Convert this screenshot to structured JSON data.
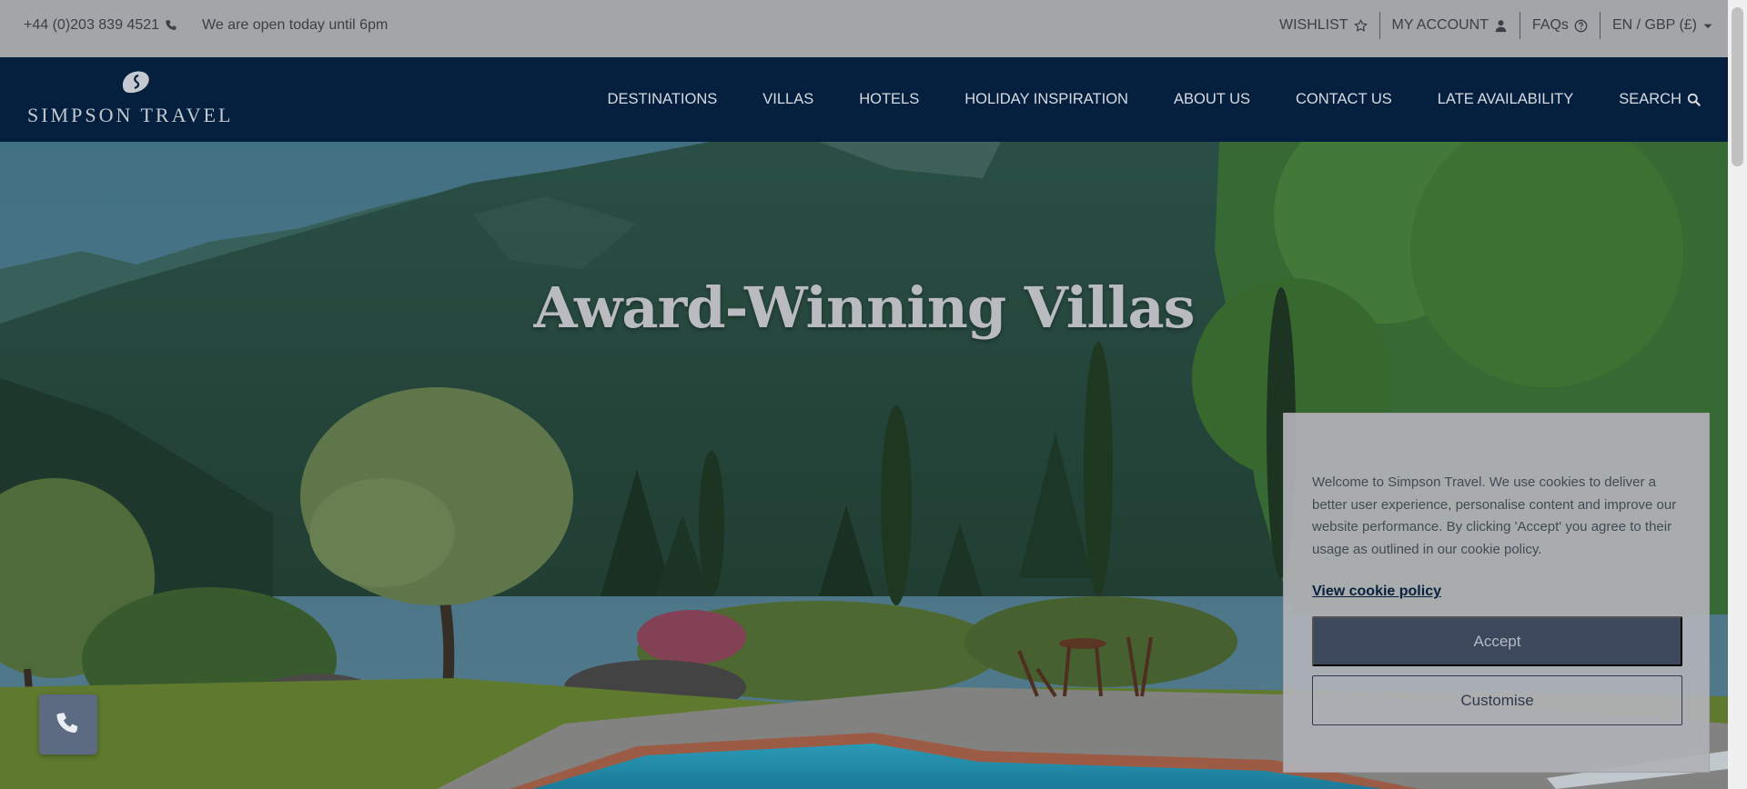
{
  "topbar": {
    "phone": "+44 (0)203 839 4521",
    "hours": "We are open today until 6pm",
    "wishlist": "WISHLIST",
    "account": "MY ACCOUNT",
    "faqs": "FAQs",
    "locale": "EN / GBP (£)"
  },
  "nav": {
    "logo_text": "SIMPSON TRAVEL",
    "items": [
      {
        "label": "DESTINATIONS"
      },
      {
        "label": "VILLAS"
      },
      {
        "label": "HOTELS"
      },
      {
        "label": "HOLIDAY INSPIRATION"
      },
      {
        "label": "ABOUT US"
      },
      {
        "label": "CONTACT US"
      },
      {
        "label": "LATE AVAILABILITY"
      },
      {
        "label": "SEARCH"
      }
    ]
  },
  "hero": {
    "title": "Award-Winning Villas"
  },
  "cookie": {
    "message": "Welcome to Simpson Travel. We use cookies to deliver a better user experience, personalise content and improve our website performance. By clicking 'Accept' you agree to their usage as outlined in our cookie policy.",
    "policy_link": "View cookie policy",
    "accept_label": "Accept",
    "customise_label": "Customise"
  },
  "colors": {
    "topbar_bg": "#a3a5a9",
    "nav_bg": "#05203f",
    "accept_bg": "#3c495c",
    "policy_link": "#08203d"
  },
  "icons": {
    "phone": "phone-icon",
    "wishlist": "star-icon",
    "account": "user-icon",
    "faqs": "question-circle-icon",
    "locale": "caret-down-icon",
    "search": "search-icon",
    "logo": "logo-mark-icon",
    "call": "phone-icon"
  }
}
